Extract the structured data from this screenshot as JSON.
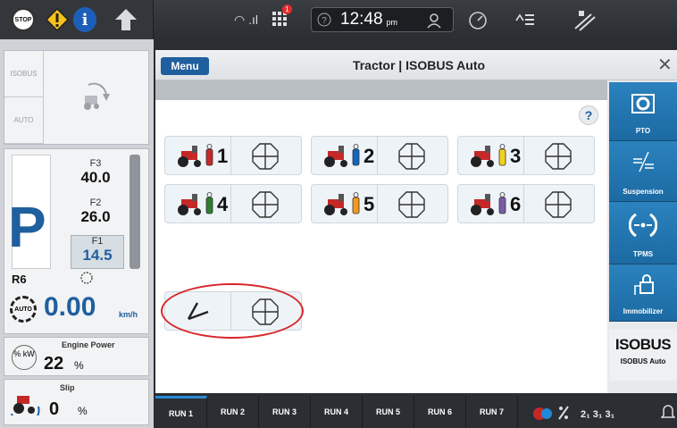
{
  "statusbar": {
    "stop_label": "STOP",
    "info_label": "i",
    "notification_count": "1",
    "time": "12:48",
    "ampm": "pm"
  },
  "left_panel": {
    "mode_tabs": [
      "ISOBUS",
      "AUTO"
    ],
    "gears": [
      {
        "label": "F3",
        "value": "40.0"
      },
      {
        "label": "F2",
        "value": "26.0"
      },
      {
        "label": "F1",
        "value": "14.5"
      }
    ],
    "park_label": "P",
    "range_label": "R6",
    "auto_label": "AUTO",
    "speed_value": "0.00",
    "speed_unit": "km/h",
    "engine_power_label": "Engine Power",
    "engine_power_value": "22",
    "engine_power_unit": "%",
    "engine_power_icon_text": "% kW",
    "slip_label": "Slip",
    "slip_value": "0",
    "slip_unit": "%"
  },
  "window": {
    "menu_label": "Menu",
    "title": "Tractor | ISOBUS Auto",
    "help_label": "?"
  },
  "remotes": [
    {
      "number": "1",
      "color": "#c62828"
    },
    {
      "number": "2",
      "color": "#1565c0"
    },
    {
      "number": "3",
      "color": "#f2d21c"
    },
    {
      "number": "4",
      "color": "#2e7d32"
    },
    {
      "number": "5",
      "color": "#f39a1d"
    },
    {
      "number": "6",
      "color": "#7a5ba8"
    }
  ],
  "right_panel": [
    {
      "label": "PTO",
      "icon": "pto-icon"
    },
    {
      "label": "Suspension",
      "icon": "suspension-icon"
    },
    {
      "label": "TPMS",
      "icon": "tpms-icon"
    },
    {
      "label": "Immobilizer",
      "icon": "immobilizer-icon"
    }
  ],
  "isobus_button": {
    "big": "ISOBUS",
    "small": "ISOBUS Auto"
  },
  "run_tabs": [
    "RUN 1",
    "RUN 2",
    "RUN 3",
    "RUN 4",
    "RUN 5",
    "RUN 6",
    "RUN 7"
  ],
  "colors": {
    "accent": "#1f5f9e",
    "highlight": "#d8262b",
    "panel_blue": "#1c6aa3"
  }
}
